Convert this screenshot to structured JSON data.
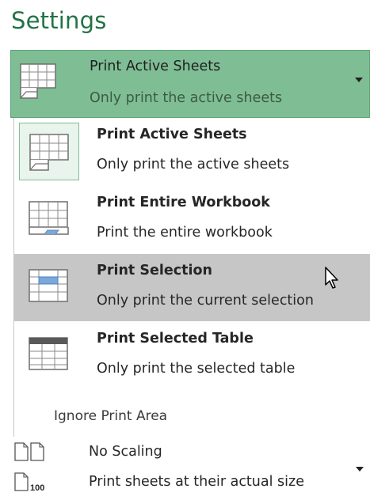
{
  "section": {
    "title": "Settings"
  },
  "print_what": {
    "selected_title": "Print Active Sheets",
    "selected_desc": "Only print the active sheets",
    "icon": "sheet-icon"
  },
  "menu": {
    "items": [
      {
        "title": "Print Active Sheets",
        "desc": "Only print the active sheets",
        "icon": "active-sheets-icon",
        "checked": true
      },
      {
        "title": "Print Entire Workbook",
        "desc": "Print the entire workbook",
        "icon": "entire-workbook-icon",
        "checked": false
      },
      {
        "title": "Print Selection",
        "desc": "Only print the current selection",
        "icon": "selection-icon",
        "checked": false,
        "hovered": true
      },
      {
        "title": "Print Selected Table",
        "desc": "Only print the selected table",
        "icon": "selected-table-icon",
        "checked": false
      }
    ],
    "ignore_print_area": "Ignore Print Area"
  },
  "scaling": {
    "title": "No Scaling",
    "desc": "Print sheets at their actual size",
    "icon_text": "100"
  },
  "colors": {
    "accent": "#217346",
    "selected_bg": "#7fbe94",
    "hover_bg": "#c6c6c6",
    "selection_highlight": "#7ba7d9"
  }
}
